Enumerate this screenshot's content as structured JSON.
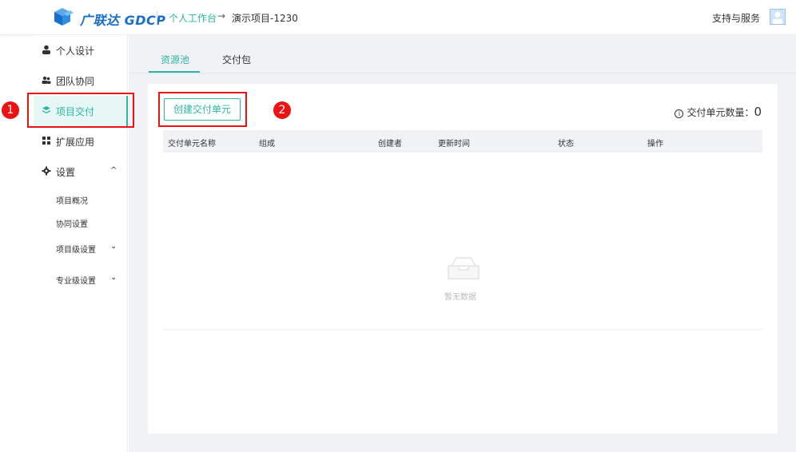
{
  "header": {
    "brand": "广联达 GDCP",
    "breadcrumb_link": "个人工作台",
    "breadcrumb_arrow": "→",
    "breadcrumb_current": "演示项目-1230",
    "support": "支持与服务"
  },
  "sidebar": {
    "items": [
      {
        "label": "个人设计",
        "icon": "user-icon"
      },
      {
        "label": "团队协同",
        "icon": "team-icon"
      },
      {
        "label": "项目交付",
        "icon": "layers-icon"
      },
      {
        "label": "扩展应用",
        "icon": "apps-icon"
      },
      {
        "label": "设置",
        "icon": "gear-icon"
      }
    ],
    "settings_sub": [
      {
        "label": "项目概况"
      },
      {
        "label": "协同设置"
      },
      {
        "label": "项目级设置"
      },
      {
        "label": "专业级设置"
      }
    ]
  },
  "tabs": [
    {
      "label": "资源池"
    },
    {
      "label": "交付包"
    }
  ],
  "toolbar": {
    "create_label": "创建交付单元",
    "count_label": "交付单元数量：",
    "count_value": "0"
  },
  "table": {
    "columns": [
      "交付单元名称",
      "组成",
      "创建者",
      "更新时间",
      "状态",
      "操作"
    ],
    "empty_text": "暂无数据"
  },
  "annotations": {
    "badge1": "1",
    "badge2": "2"
  },
  "colors": {
    "accent": "#2cb5a5",
    "brand": "#1a6fc9",
    "annotation": "#e11111"
  }
}
